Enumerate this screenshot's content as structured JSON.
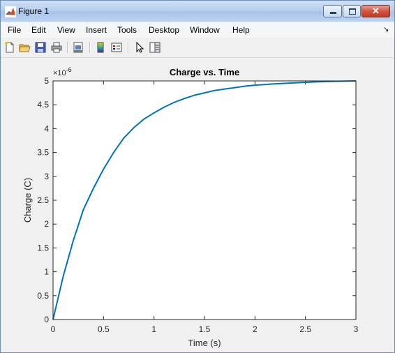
{
  "window": {
    "title": "Figure 1"
  },
  "menu": [
    "File",
    "Edit",
    "View",
    "Insert",
    "Tools",
    "Desktop",
    "Window",
    "Help"
  ],
  "toolbar": {
    "icons": [
      "new-figure-icon",
      "open-file-icon",
      "save-icon",
      "print-icon",
      "print-preview-icon",
      "colorbar-icon",
      "legend-icon",
      "pointer-icon",
      "property-editor-icon"
    ]
  },
  "chart_data": {
    "type": "line",
    "title": "Charge vs. Time",
    "xlabel": "Time (s)",
    "ylabel": "Charge (C)",
    "exponent_label": "×10",
    "exponent_value": "-6",
    "xlim": [
      0,
      3
    ],
    "ylim": [
      0,
      5
    ],
    "x_ticks": [
      "0",
      "0.5",
      "1",
      "1.5",
      "2",
      "2.5",
      "3"
    ],
    "y_ticks": [
      "0",
      "0.5",
      "1",
      "1.5",
      "2",
      "2.5",
      "3",
      "3.5",
      "4",
      "4.5",
      "5"
    ],
    "series": [
      {
        "color": "#0072bd",
        "x": [
          0,
          0.1,
          0.2,
          0.3,
          0.4,
          0.5,
          0.6,
          0.7,
          0.8,
          0.9,
          1.0,
          1.1,
          1.2,
          1.3,
          1.4,
          1.5,
          1.6,
          1.7,
          1.8,
          1.9,
          2.0,
          2.2,
          2.4,
          2.6,
          2.8,
          3.0
        ],
        "y": [
          0,
          0.9,
          1.65,
          2.3,
          2.75,
          3.15,
          3.5,
          3.8,
          4.02,
          4.2,
          4.33,
          4.45,
          4.55,
          4.63,
          4.7,
          4.75,
          4.8,
          4.83,
          4.86,
          4.89,
          4.91,
          4.94,
          4.96,
          4.98,
          4.99,
          5.0
        ]
      }
    ],
    "grid": false,
    "colors": {
      "axes_face": "#ffffff",
      "axes_edge": "#262626",
      "figure_bg": "#f0f0f0"
    }
  }
}
